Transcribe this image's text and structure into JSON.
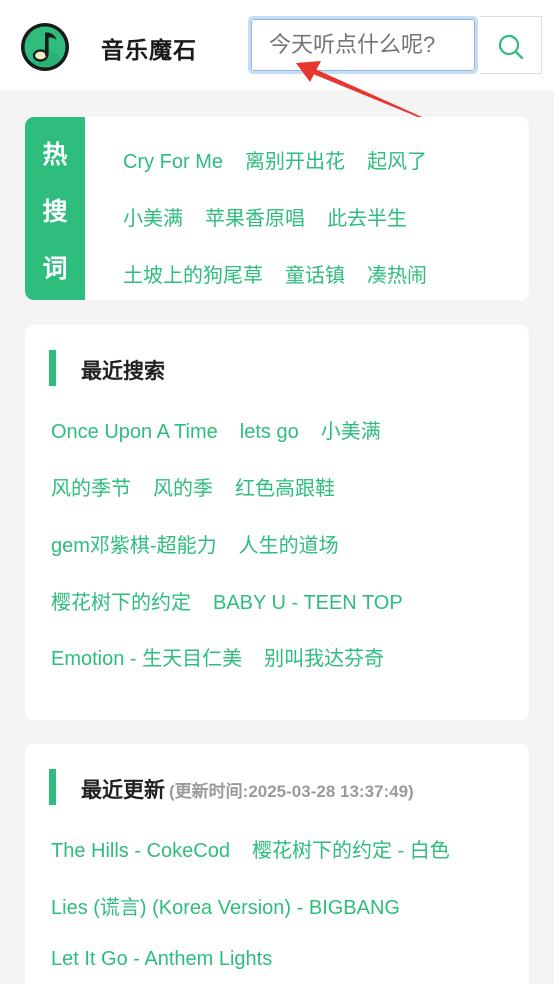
{
  "header": {
    "brand": "音乐魔石",
    "search_placeholder": "今天听点什么呢?"
  },
  "hot": {
    "label": [
      "热",
      "搜",
      "词"
    ],
    "rows": [
      [
        "Cry For Me",
        "离别开出花",
        "起风了"
      ],
      [
        "小美满",
        "苹果香原唱",
        "此去半生"
      ],
      [
        "土坡上的狗尾草",
        "童话镇",
        "凑热闹"
      ]
    ]
  },
  "recent_search": {
    "title": "最近搜索",
    "rows": [
      [
        "Once Upon A Time",
        "lets go",
        "小美满"
      ],
      [
        "风的季节",
        "风的季",
        "红色高跟鞋"
      ],
      [
        "gem邓紫棋-超能力",
        "人生的道场"
      ],
      [
        "樱花树下的约定",
        "BABY U - TEEN TOP"
      ],
      [
        "Emotion - 生天目仁美",
        "别叫我达芬奇"
      ]
    ]
  },
  "recent_update": {
    "title": "最近更新",
    "subtitle": "(更新时间:2025-03-28 13:37:49)",
    "rows": [
      [
        "The Hills - CokeCod",
        "樱花树下的约定 - 白色"
      ],
      [
        "Lies (谎言) (Korea Version) - BIGBANG"
      ],
      [
        "Let It Go - Anthem Lights"
      ]
    ]
  },
  "colors": {
    "accent": "#2ebd7c",
    "background": "#f4f4f4",
    "annotation_arrow": "#e8352e"
  }
}
